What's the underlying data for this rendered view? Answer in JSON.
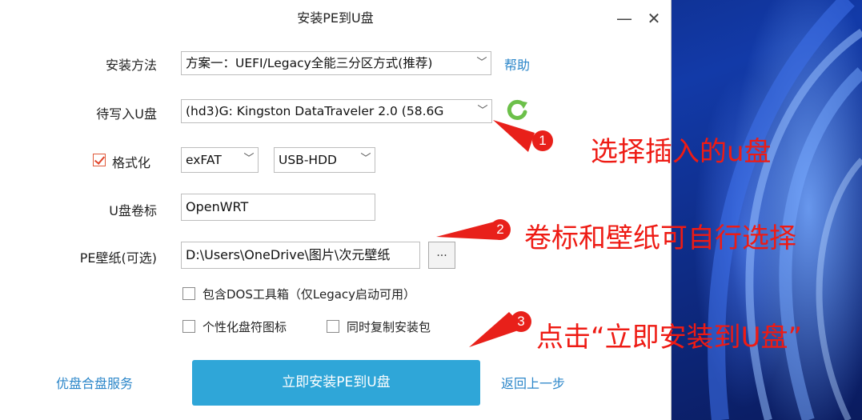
{
  "window": {
    "title": "安装PE到U盘",
    "minimize": "—",
    "close": "✕"
  },
  "form": {
    "install_method": {
      "label": "安装方法",
      "value": "方案一：UEFI/Legacy全能三分区方式(推荐)"
    },
    "help_link": "帮助",
    "target_disk": {
      "label": "待写入U盘",
      "value": "(hd3)G: Kingston DataTraveler 2.0 (58.6G"
    },
    "format": {
      "label": "格式化",
      "checked": true,
      "filesystem": "exFAT",
      "mode": "USB-HDD"
    },
    "volume_label": {
      "label": "U盘卷标",
      "value": "OpenWRT"
    },
    "wallpaper": {
      "label": "PE壁纸(可选)",
      "value": "D:\\Users\\OneDrive\\图片\\次元壁纸",
      "browse": "..."
    },
    "options": {
      "dos_toolbox": "包含DOS工具箱（仅Legacy启动可用）",
      "personalize_icon": "个性化盘符图标",
      "copy_installer": "同时复制安装包"
    }
  },
  "footer": {
    "left_link": "优盘合盘服务",
    "primary_button": "立即安装PE到U盘",
    "back_link": "返回上一步"
  },
  "annotations": {
    "step1_num": "1",
    "step1_text": "选择插入的u盘",
    "step2_num": "2",
    "step2_text": "卷标和壁纸可自行选择",
    "step3_num": "3",
    "step3_text": "点击“立即安装到U盘”"
  },
  "colors": {
    "accent": "#2fa6d8",
    "link": "#2b86c9",
    "annotation": "#ee1b14",
    "refresh": "#6cc04a"
  },
  "icons": {
    "refresh": "refresh-icon",
    "dropdown": "chevron-down-icon"
  }
}
